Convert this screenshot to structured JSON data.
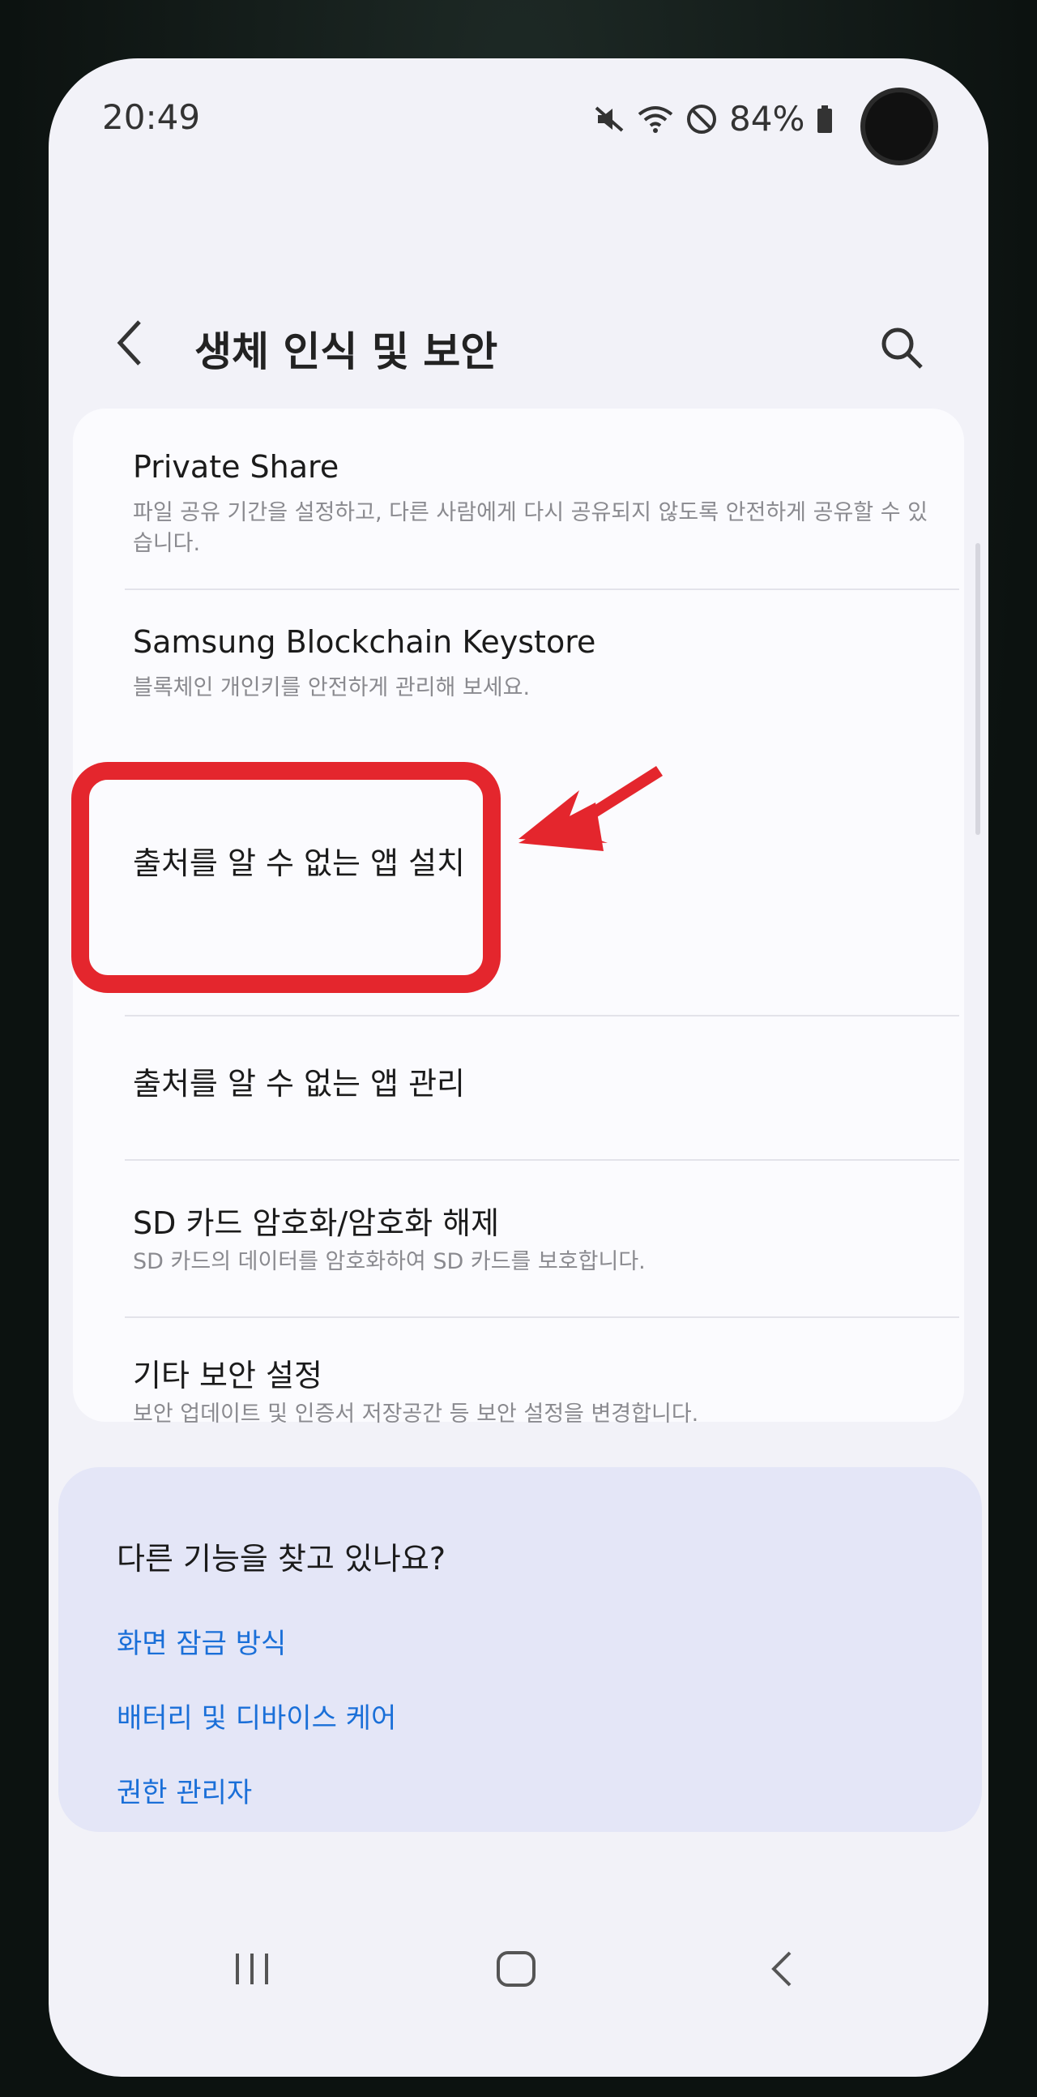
{
  "status": {
    "time": "20:49",
    "battery": "84%",
    "icons": [
      "mute-icon",
      "wifi-icon",
      "do-not-disturb-icon",
      "battery-icon"
    ]
  },
  "appbar": {
    "title": "생체 인식 및 보안",
    "back_icon": "chevron-left-icon",
    "search_icon": "search-icon"
  },
  "settings": {
    "items": [
      {
        "title": "Private Share",
        "subtitle": "파일 공유 기간을 설정하고, 다른 사람에게 다시 공유되지 않도록 안전하게 공유할 수 있습니다."
      },
      {
        "title": "Samsung Blockchain Keystore",
        "subtitle": "블록체인 개인키를 안전하게 관리해 보세요."
      },
      {
        "title": "출처를 알 수 없는 앱 설치",
        "subtitle": ""
      },
      {
        "title": "출처를 알 수 없는 앱 관리",
        "subtitle": ""
      },
      {
        "title": "SD 카드 암호화/암호화 해제",
        "subtitle": "SD 카드의 데이터를 암호화하여 SD 카드를 보호합니다."
      },
      {
        "title": "기타 보안 설정",
        "subtitle": "보안 업데이트 및 인증서 저장공간 등 보안 설정을 변경합니다."
      }
    ]
  },
  "help": {
    "title": "다른 기능을 찾고 있나요?",
    "links": [
      "화면 잠금 방식",
      "배터리 및 디바이스 케어",
      "권한 관리자"
    ]
  },
  "navbar": {
    "icons": [
      "recent-apps-icon",
      "home-icon",
      "back-icon"
    ]
  },
  "colors": {
    "link": "#1a6fd8",
    "highlight": "#e4262d",
    "background": "#f2f2f8"
  }
}
